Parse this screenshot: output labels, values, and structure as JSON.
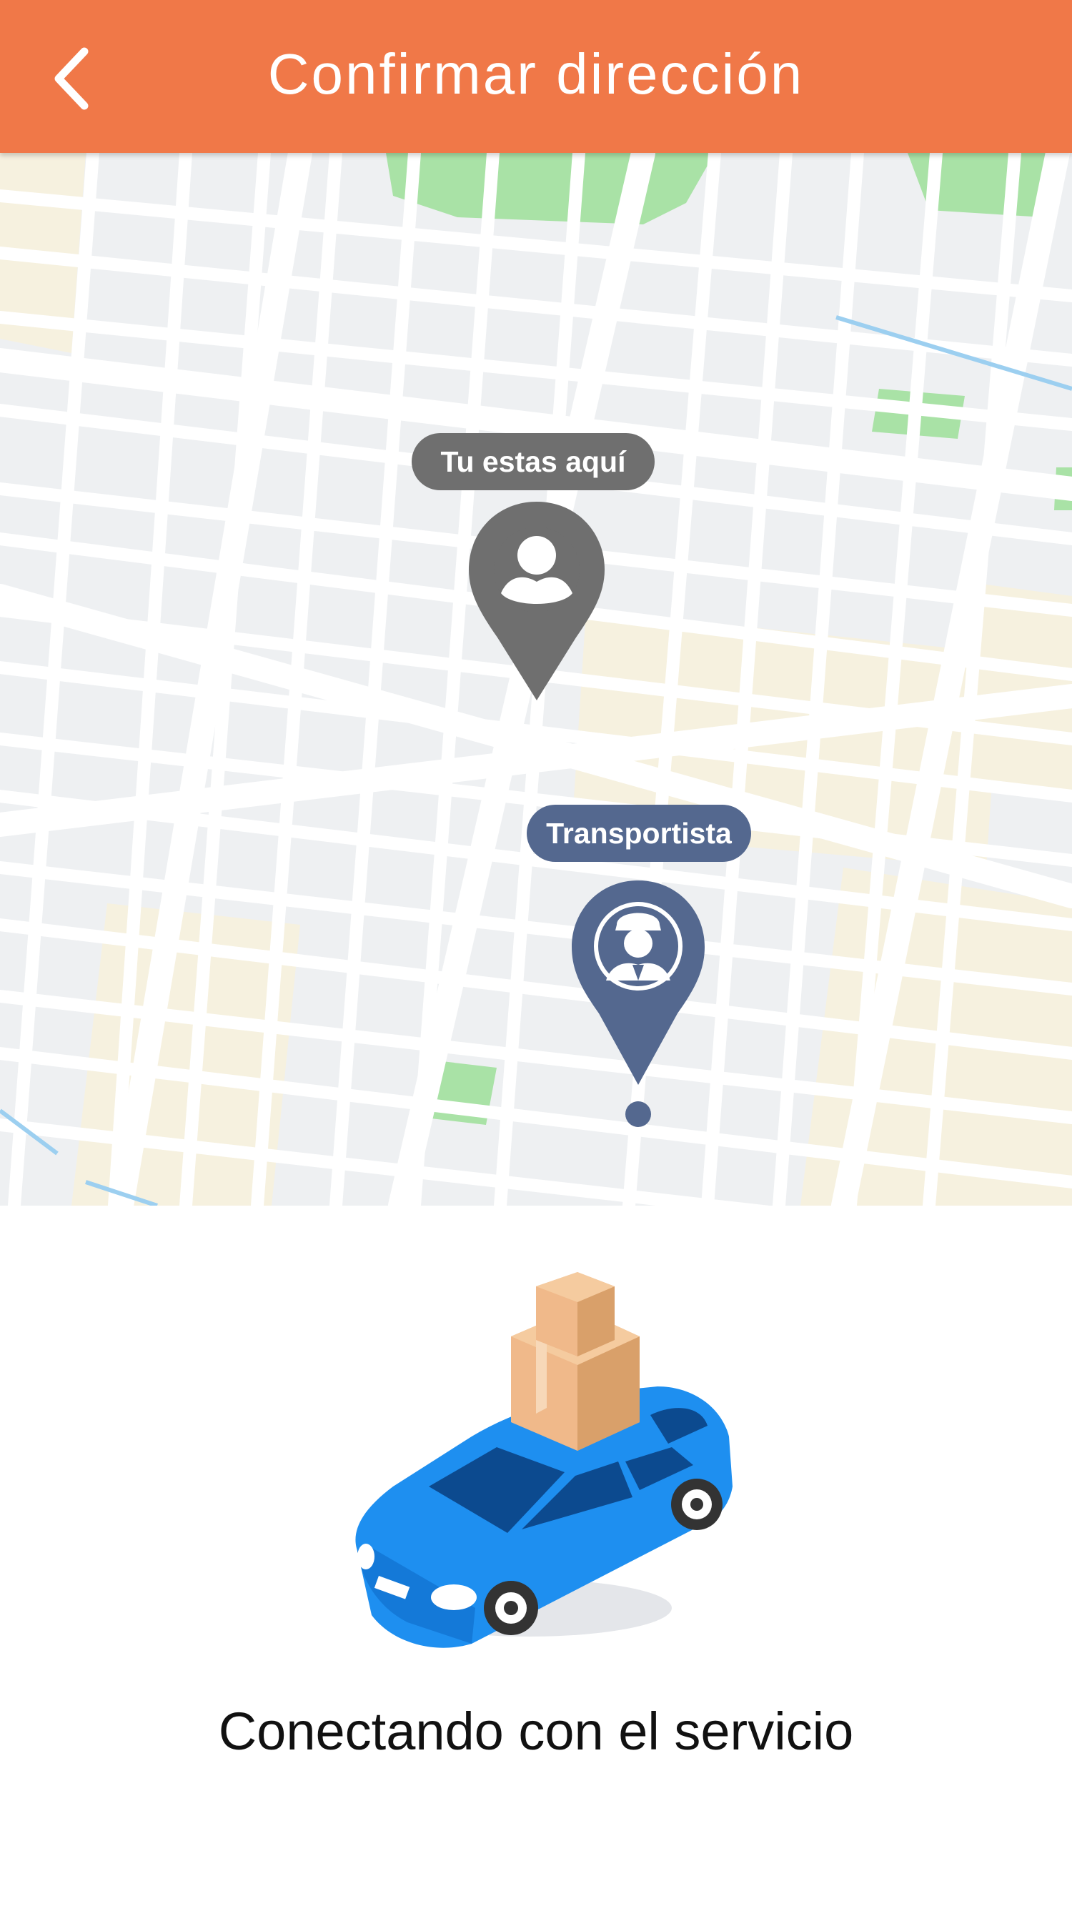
{
  "header": {
    "title": "Confirmar dirección",
    "back_icon": "chevron-left-icon",
    "background_color": "#f07848"
  },
  "map": {
    "user_marker": {
      "label": "Tu estas aquí",
      "icon": "user-location-pin-icon",
      "color": "#6f6f6f"
    },
    "driver_marker": {
      "label": "Transportista",
      "icon": "driver-location-pin-icon",
      "color": "#54688f"
    }
  },
  "illustration": {
    "icon": "car-with-packages-icon"
  },
  "status": {
    "text": "Conectando con el servicio"
  }
}
